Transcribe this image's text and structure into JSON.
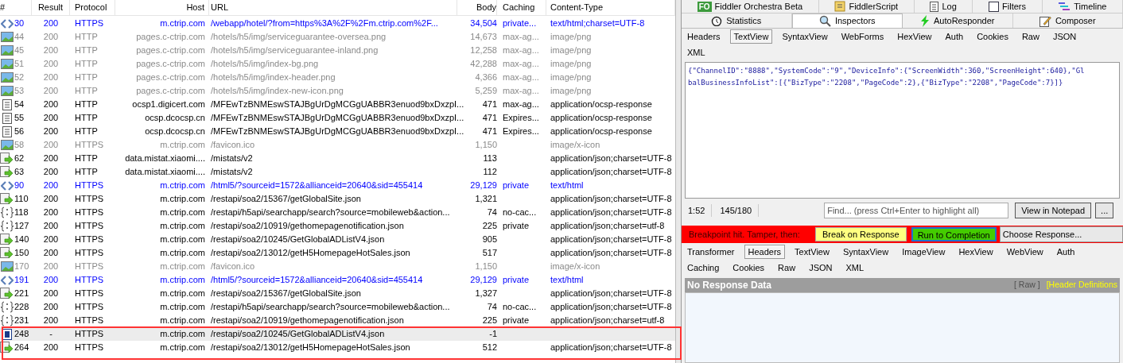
{
  "sessions": {
    "columns": [
      "#",
      "Result",
      "Protocol",
      "Host",
      "URL",
      "Body",
      "Caching",
      "Content-Type"
    ],
    "rows": [
      {
        "kind": "html",
        "number": "30",
        "result": "200",
        "protocol": "HTTPS",
        "host": "m.ctrip.com",
        "url": "/webapp/hotel/?from=https%3A%2F%2Fm.ctrip.com%2F...",
        "body": "34,504",
        "caching": "private...",
        "content_type": "text/html;charset=UTF-8",
        "selected": false
      },
      {
        "kind": "image",
        "number": "44",
        "result": "200",
        "protocol": "HTTP",
        "host": "pages.c-ctrip.com",
        "url": "/hotels/h5/img/serviceguarantee-oversea.png",
        "body": "14,673",
        "caching": "max-ag...",
        "content_type": "image/png",
        "selected": false
      },
      {
        "kind": "image",
        "number": "45",
        "result": "200",
        "protocol": "HTTP",
        "host": "pages.c-ctrip.com",
        "url": "/hotels/h5/img/serviceguarantee-inland.png",
        "body": "12,258",
        "caching": "max-ag...",
        "content_type": "image/png",
        "selected": false
      },
      {
        "kind": "image",
        "number": "51",
        "result": "200",
        "protocol": "HTTP",
        "host": "pages.c-ctrip.com",
        "url": "/hotels/h5/img/index-bg.png",
        "body": "42,288",
        "caching": "max-ag...",
        "content_type": "image/png",
        "selected": false
      },
      {
        "kind": "image",
        "number": "52",
        "result": "200",
        "protocol": "HTTP",
        "host": "pages.c-ctrip.com",
        "url": "/hotels/h5/img/index-header.png",
        "body": "4,366",
        "caching": "max-ag...",
        "content_type": "image/png",
        "selected": false
      },
      {
        "kind": "image",
        "number": "53",
        "result": "200",
        "protocol": "HTTP",
        "host": "pages.c-ctrip.com",
        "url": "/hotels/h5/img/index-new-icon.png",
        "body": "5,259",
        "caching": "max-ag...",
        "content_type": "image/png",
        "selected": false
      },
      {
        "kind": "document",
        "number": "54",
        "result": "200",
        "protocol": "HTTP",
        "host": "ocsp1.digicert.com",
        "url": "/MFEwTzBNMEswSTAJBgUrDgMCGgUABBR3enuod9bxDxzpI...",
        "body": "471",
        "caching": "max-ag...",
        "content_type": "application/ocsp-response",
        "selected": false
      },
      {
        "kind": "document",
        "number": "55",
        "result": "200",
        "protocol": "HTTP",
        "host": "ocsp.dcocsp.cn",
        "url": "/MFEwTzBNMEswSTAJBgUrDgMCGgUABBR3enuod9bxDxzpI...",
        "body": "471",
        "caching": "Expires...",
        "content_type": "application/ocsp-response",
        "selected": false
      },
      {
        "kind": "document",
        "number": "56",
        "result": "200",
        "protocol": "HTTP",
        "host": "ocsp.dcocsp.cn",
        "url": "/MFEwTzBNMEswSTAJBgUrDgMCGgUABBR3enuod9bxDxzpI...",
        "body": "471",
        "caching": "Expires...",
        "content_type": "application/ocsp-response",
        "selected": false
      },
      {
        "kind": "image",
        "number": "58",
        "result": "200",
        "protocol": "HTTPS",
        "host": "m.ctrip.com",
        "url": "/favicon.ico",
        "body": "1,150",
        "content_type": "image/x-icon",
        "selected": false
      },
      {
        "kind": "post",
        "number": "62",
        "result": "200",
        "protocol": "HTTP",
        "host": "data.mistat.xiaomi....",
        "url": "/mistats/v2",
        "body": "113",
        "content_type": "application/json;charset=UTF-8",
        "selected": false
      },
      {
        "kind": "post",
        "number": "63",
        "result": "200",
        "protocol": "HTTP",
        "host": "data.mistat.xiaomi....",
        "url": "/mistats/v2",
        "body": "112",
        "content_type": "application/json;charset=UTF-8",
        "selected": false
      },
      {
        "kind": "html",
        "number": "90",
        "result": "200",
        "protocol": "HTTPS",
        "host": "m.ctrip.com",
        "url": "/html5/?sourceid=1572&allianceid=20640&sid=455414",
        "body": "29,129",
        "caching": "private",
        "content_type": "text/html",
        "selected": false
      },
      {
        "kind": "post",
        "number": "110",
        "result": "200",
        "protocol": "HTTPS",
        "host": "m.ctrip.com",
        "url": "/restapi/soa2/15367/getGlobalSite.json",
        "body": "1,321",
        "content_type": "application/json;charset=UTF-8",
        "selected": false
      },
      {
        "kind": "json",
        "number": "118",
        "result": "200",
        "protocol": "HTTPS",
        "host": "m.ctrip.com",
        "url": "/restapi/h5api/searchapp/search?source=mobileweb&action...",
        "body": "74",
        "caching": "no-cac...",
        "content_type": "application/json;charset=UTF-8",
        "selected": false
      },
      {
        "kind": "json",
        "number": "127",
        "result": "200",
        "protocol": "HTTPS",
        "host": "m.ctrip.com",
        "url": "/restapi/soa2/10919/gethomepagenotification.json",
        "body": "225",
        "caching": "private",
        "content_type": "application/json;charset=utf-8",
        "selected": false
      },
      {
        "kind": "post",
        "number": "140",
        "result": "200",
        "protocol": "HTTPS",
        "host": "m.ctrip.com",
        "url": "/restapi/soa2/10245/GetGlobalADListV4.json",
        "body": "905",
        "content_type": "application/json;charset=UTF-8",
        "selected": false
      },
      {
        "kind": "post",
        "number": "150",
        "result": "200",
        "protocol": "HTTPS",
        "host": "m.ctrip.com",
        "url": "/restapi/soa2/13012/getH5HomepageHotSales.json",
        "body": "517",
        "content_type": "application/json;charset=UTF-8",
        "selected": false
      },
      {
        "kind": "image",
        "number": "170",
        "result": "200",
        "protocol": "HTTPS",
        "host": "m.ctrip.com",
        "url": "/favicon.ico",
        "body": "1,150",
        "content_type": "image/x-icon",
        "selected": false
      },
      {
        "kind": "html",
        "number": "191",
        "result": "200",
        "protocol": "HTTPS",
        "host": "m.ctrip.com",
        "url": "/html5/?sourceid=1572&allianceid=20640&sid=455414",
        "body": "29,129",
        "caching": "private",
        "content_type": "text/html",
        "selected": false
      },
      {
        "kind": "post",
        "number": "221",
        "result": "200",
        "protocol": "HTTPS",
        "host": "m.ctrip.com",
        "url": "/restapi/soa2/15367/getGlobalSite.json",
        "body": "1,327",
        "content_type": "application/json;charset=UTF-8",
        "selected": false
      },
      {
        "kind": "json",
        "number": "228",
        "result": "200",
        "protocol": "HTTPS",
        "host": "m.ctrip.com",
        "url": "/restapi/h5api/searchapp/search?source=mobileweb&action...",
        "body": "74",
        "caching": "no-cac...",
        "content_type": "application/json;charset=UTF-8",
        "selected": false
      },
      {
        "kind": "json",
        "number": "231",
        "result": "200",
        "protocol": "HTTPS",
        "host": "m.ctrip.com",
        "url": "/restapi/soa2/10919/gethomepagenotification.json",
        "body": "225",
        "caching": "private",
        "content_type": "application/json;charset=utf-8",
        "selected": false
      },
      {
        "kind": "breakpoint",
        "number": "248",
        "result": "-",
        "protocol": "HTTPS",
        "host": "m.ctrip.com",
        "url": "/restapi/soa2/10245/GetGlobalADListV4.json",
        "body": "-1",
        "selected": true
      },
      {
        "kind": "post",
        "number": "264",
        "result": "200",
        "protocol": "HTTPS",
        "host": "m.ctrip.com",
        "url": "/restapi/soa2/13012/getH5HomepageHotSales.json",
        "body": "512",
        "content_type": "application/json;charset=UTF-8",
        "selected": false
      }
    ]
  },
  "top_tabs": [
    {
      "kind": "orchestra",
      "badge": "FO",
      "label": "Fiddler Orchestra Beta"
    },
    {
      "kind": "script",
      "label": "FiddlerScript"
    },
    {
      "kind": "log",
      "label": "Log"
    },
    {
      "kind": "filters",
      "label": "Filters"
    },
    {
      "kind": "timeline",
      "label": "Timeline"
    }
  ],
  "main_tabs": [
    {
      "kind": "statistics",
      "label": "Statistics",
      "selected": false
    },
    {
      "kind": "inspectors",
      "label": "Inspectors",
      "selected": true
    },
    {
      "kind": "autoresponder",
      "label": "AutoResponder",
      "selected": false
    },
    {
      "kind": "composer",
      "label": "Composer",
      "selected": false
    }
  ],
  "request_tabs": [
    [
      {
        "label": "Headers",
        "selected": false
      },
      {
        "label": "TextView",
        "selected": true
      },
      {
        "label": "SyntaxView",
        "selected": false
      },
      {
        "label": "WebForms",
        "selected": false
      },
      {
        "label": "HexView",
        "selected": false
      },
      {
        "label": "Auth",
        "selected": false
      },
      {
        "label": "Cookies",
        "selected": false
      },
      {
        "label": "Raw",
        "selected": false
      },
      {
        "label": "JSON",
        "selected": false
      }
    ],
    [
      {
        "label": "XML",
        "selected": false
      }
    ]
  ],
  "request_text": [
    "{\"ChannelID\":\"8888\",\"SystemCode\":\"9\",\"DeviceInfo\":{\"ScreenWidth\":360,\"ScreenHeight\":640},\"Gl",
    "balBusinessInfoList\":[{\"BizType\":\"2208\",\"PageCode\":2},{\"BizType\":\"2208\",\"PageCode\":7}]}"
  ],
  "status": {
    "position": "1:52",
    "count": "145/180",
    "find_placeholder": "Find... (press Ctrl+Enter to highlight all)",
    "notepad_button": "View in Notepad",
    "more_button": "..."
  },
  "breakpoint_bar": {
    "message": "Breakpoint hit. Tamper, then:",
    "break_button": "Break on Response",
    "run_button": "Run to Completion",
    "choose_response": "Choose Response..."
  },
  "response_tabs": [
    [
      {
        "label": "Transformer",
        "selected": false
      },
      {
        "label": "Headers",
        "selected": true
      },
      {
        "label": "TextView",
        "selected": false
      },
      {
        "label": "SyntaxView",
        "selected": false
      },
      {
        "label": "ImageView",
        "selected": false
      },
      {
        "label": "HexView",
        "selected": false
      },
      {
        "label": "WebView",
        "selected": false
      },
      {
        "label": "Auth",
        "selected": false
      }
    ],
    [
      {
        "label": "Caching",
        "selected": false
      },
      {
        "label": "Cookies",
        "selected": false
      },
      {
        "label": "Raw",
        "selected": false
      },
      {
        "label": "JSON",
        "selected": false
      },
      {
        "label": "XML",
        "selected": false
      }
    ]
  ],
  "response_header": {
    "title": "No Response Data",
    "raw_link": "[ Raw ]",
    "definitions_link": "[Header Definitions"
  }
}
